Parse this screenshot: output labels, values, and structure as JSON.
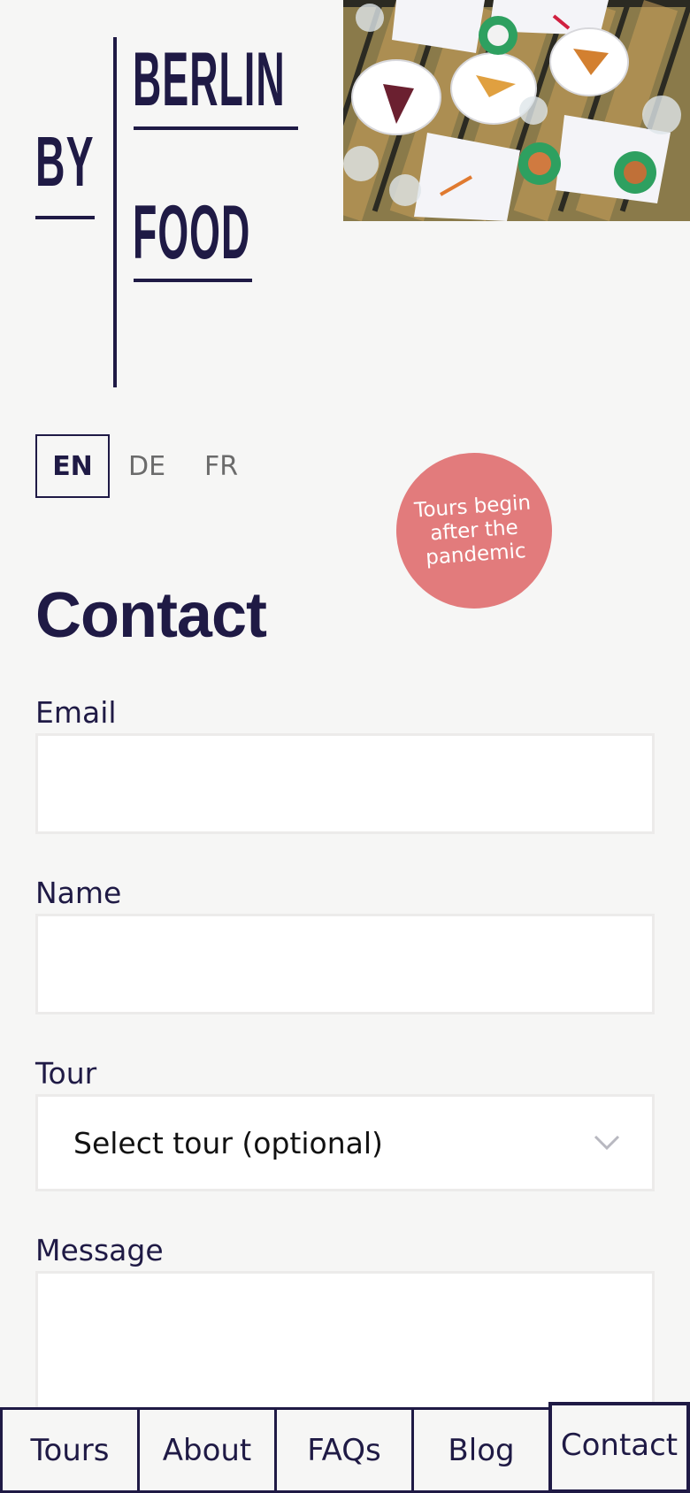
{
  "logo": {
    "by": "BY",
    "berlin": "BERLIN",
    "food": "FOOD"
  },
  "languages": [
    {
      "label": "EN",
      "active": true
    },
    {
      "label": "DE",
      "active": false
    },
    {
      "label": "FR",
      "active": false
    }
  ],
  "badge": {
    "text": "Tours begin after the pandemic",
    "color": "#e27b7c"
  },
  "page_title": "Contact",
  "form": {
    "email_label": "Email",
    "email_value": "",
    "name_label": "Name",
    "name_value": "",
    "tour_label": "Tour",
    "tour_selected": "Select tour (optional)",
    "message_label": "Message",
    "message_value": ""
  },
  "nav": {
    "items": [
      "Tours",
      "About",
      "FAQs",
      "Blog",
      "Contact"
    ],
    "active": "Contact"
  },
  "colors": {
    "primary": "#1f1a45",
    "background": "#f6f6f5"
  }
}
